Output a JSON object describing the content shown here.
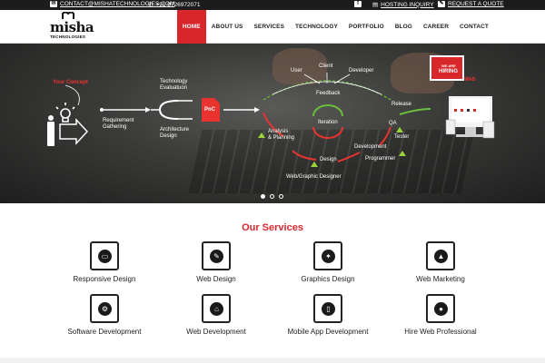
{
  "topbar": {
    "email": "CONTACT@MISHATECHNOLOGIES.COM",
    "phone": "+91 9726972071",
    "hosting_label": "HOSTING INQUIRY",
    "quote_label": "REQUEST A QUOTE"
  },
  "logo": {
    "word": "misha",
    "sub": "TECHNOLOGIES"
  },
  "nav": [
    "HOME",
    "ABOUT US",
    "SERVICES",
    "TECHNOLOGY",
    "PORTFOLIO",
    "BLOG",
    "CAREER",
    "CONTACT"
  ],
  "hero": {
    "your_concept": "Your Concept",
    "requirement": "Requirement\nGathering",
    "tech_eval": "Technology\nEvaluatuon",
    "architecture": "Architecture\nDesign",
    "poc": "PoC",
    "user": "User",
    "client": "Client",
    "developer": "Developer",
    "feedback": "Feedback",
    "iteration": "Iteration",
    "analysis": "Analysis\n& Planning",
    "design": "Design",
    "development": "Development",
    "qa": "QA",
    "tester": "Tester",
    "release": "Release",
    "programmer": "Programmer",
    "web_designer": "Web/Graphic Designer",
    "hiring_top": "WE ARE",
    "hiring_main": "HIRING",
    "web_tag": "Web",
    "slides": [
      true,
      false,
      false
    ]
  },
  "services": {
    "title": "Our Services",
    "items": [
      {
        "name": "Responsive Design",
        "icon": "responsive-icon",
        "glyph": "▭"
      },
      {
        "name": "Web Design",
        "icon": "web-design-icon",
        "glyph": "✎"
      },
      {
        "name": "Graphics Design",
        "icon": "graphics-icon",
        "glyph": "✦"
      },
      {
        "name": "Web Marketing",
        "icon": "marketing-icon",
        "glyph": "▲"
      },
      {
        "name": "Software Development",
        "icon": "software-icon",
        "glyph": "⚙"
      },
      {
        "name": "Web Development",
        "icon": "web-dev-icon",
        "glyph": "⌂"
      },
      {
        "name": "Mobile App Development",
        "icon": "mobile-icon",
        "glyph": "▯"
      },
      {
        "name": "Hire Web Professional",
        "icon": "professional-icon",
        "glyph": "●"
      }
    ]
  },
  "colors": {
    "accent": "#d9262b",
    "topbar": "#1c1c1c",
    "arrow_green": "#6abf3b",
    "arrow_red": "#e8332e"
  }
}
